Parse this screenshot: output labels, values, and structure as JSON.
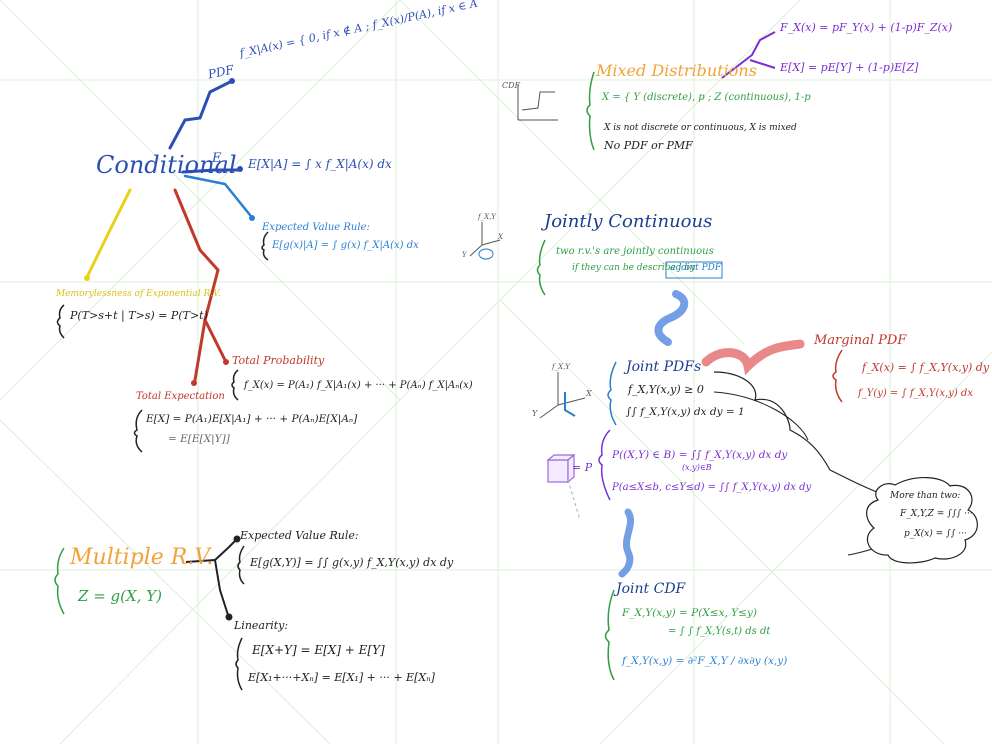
{
  "colors": {
    "blue": "#2b4fb4",
    "lightblue": "#2a7fd0",
    "yellow": "#e6d21a",
    "red": "#c0392b",
    "orange": "#f2a23a",
    "green": "#2f9e44",
    "purple": "#7b2fd3",
    "navy": "#1d3f8f",
    "black": "#222222",
    "grid": "#dcefd8"
  },
  "conditional": {
    "title": "Conditional",
    "pdf_label": "PDF",
    "pdf_formula": "f_X|A(x) = { 0, if x ∉ A ; f_X(x)/P(A), if x ∈ A",
    "e_label": "E",
    "e_formula": "E[X|A] = ∫ x f_X|A(x) dx",
    "evr_title": "Expected Value Rule:",
    "evr_formula": "E[g(x)|A] = ∫ g(x) f_X|A(x) dx",
    "memoryless_title": "Memorylessness of Exponential R.V.",
    "memoryless_formula": "P(T>s+t | T>s) = P(T>t)",
    "total_prob_title": "Total Probability",
    "total_prob_formula": "f_X(x) = P(A₁) f_X|A₁(x) + ··· + P(Aₙ) f_X|Aₙ(x)",
    "total_exp_title": "Total Expectation",
    "total_exp_formula1": "E[X] = P(A₁)E[X|A₁] + ··· + P(Aₙ)E[X|Aₙ]",
    "total_exp_formula2": "= E[E[X|Y]]"
  },
  "multiple": {
    "title": "Multiple R.V.",
    "z_formula": "Z = g(X, Y)",
    "evr_title": "Expected Value Rule:",
    "evr_formula": "E[g(X,Y)] = ∫∫ g(x,y) f_X,Y(x,y) dx dy",
    "linearity_title": "Linearity:",
    "lin1": "E[X+Y] = E[X] + E[Y]",
    "lin2": "E[X₁+···+Xₙ] = E[X₁] + ··· + E[Xₙ]"
  },
  "mixed": {
    "title": "Mixed Distributions",
    "cdf_label": "CDF",
    "x_def": "X = { Y (discrete), p ; Z (continuous), 1-p",
    "note1": "X is not discrete or continuous, X is mixed",
    "note2": "No PDF or PMF",
    "fx_formula": "F_X(x) = pF_Y(x) + (1-p)F_Z(x)",
    "ex_formula": "E[X] = pE[Y] + (1-p)E[Z]"
  },
  "jointly": {
    "title": "Jointly Continuous",
    "desc1": "two r.v.'s are jointly continuous",
    "desc2a": "if they can be described by",
    "desc2b": "a joint PDF",
    "axis_fxy": "f_X,Y",
    "axis_x": "X",
    "axis_y": "Y"
  },
  "joint_pdfs": {
    "title": "Joint PDFs",
    "f1": "f_X,Y(x,y) ≥ 0",
    "f2": "∫∫ f_X,Y(x,y) dx dy = 1",
    "p1": "P((X,Y) ∈ B) = ∫∫ f_X,Y(x,y) dx dy",
    "p1_sub": "(x,y)∈B",
    "p2": "P(a≤X≤b, c≤Y≤d) = ∫∫ f_X,Y(x,y) dx dy",
    "eq_p": "= P",
    "axis_fxy": "f_X,Y",
    "axis_x": "X",
    "axis_y": "Y"
  },
  "marginal": {
    "title": "Marginal PDF",
    "fx": "f_X(x) = ∫ f_X,Y(x,y) dy",
    "fy": "f_Y(y) = ∫ f_X,Y(x,y) dx"
  },
  "more": {
    "title": "More than two:",
    "l1": "F_X,Y,Z = ∫∫∫ ···",
    "l2": "p_X(x) = ∫∫ ···"
  },
  "joint_cdf": {
    "title": "Joint CDF",
    "l1": "F_X,Y(x,y) = P(X≤x, Y≤y)",
    "l2": "= ∫ ∫ f_X,Y(s,t) ds dt",
    "l3": "f_X,Y(x,y) = ∂²F_X,Y / ∂x∂y (x,y)"
  }
}
